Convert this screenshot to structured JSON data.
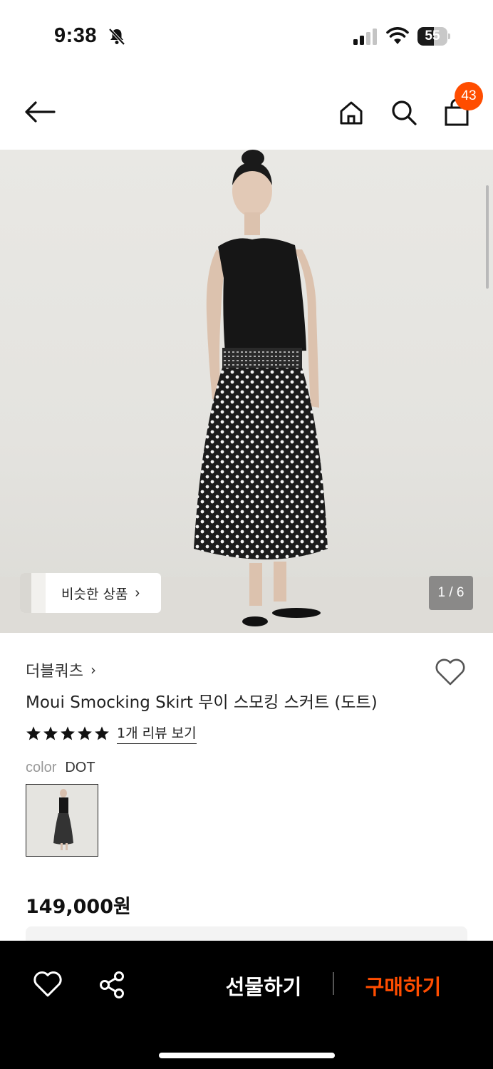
{
  "status_bar": {
    "time": "9:38",
    "battery_level": "55",
    "battery_fraction": 0.55,
    "icons": [
      "bell-off-icon",
      "signal-icon",
      "wifi-icon",
      "battery-icon"
    ]
  },
  "nav": {
    "icons": [
      "back-arrow-icon",
      "home-icon",
      "search-icon",
      "shopping-bag-icon"
    ],
    "cart_count": "43",
    "badge_color": "#ff4d00"
  },
  "gallery": {
    "similar_label": "비슷한 상품",
    "counter": "1 / 6"
  },
  "product": {
    "brand": "더블쿼츠",
    "title": "Moui Smocking Skirt 무이 스모킹 스커트 (도트)",
    "rating_stars": 5,
    "review_link": "1개 리뷰 보기",
    "color_label": "color",
    "color_value": "DOT",
    "price": "149,000원"
  },
  "bottom_bar": {
    "icons": [
      "heart-icon",
      "share-icon"
    ],
    "gift_label": "선물하기",
    "buy_label": "구매하기",
    "accent_color": "#ff4d00"
  }
}
